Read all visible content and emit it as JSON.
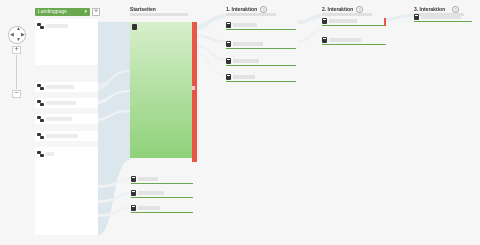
{
  "zoom": {
    "in_label": "+",
    "out_label": "−"
  },
  "dimension_selector": {
    "label": "Landingpage",
    "caret": "▾"
  },
  "add_button": "+",
  "columns": {
    "start": {
      "title": "Startseiten"
    },
    "int1": {
      "title": "1. Interaktion",
      "info": "?"
    },
    "int2": {
      "title": "2. Interaktion",
      "info": "?"
    },
    "int3": {
      "title": "3. Interaktion",
      "info": "?"
    }
  },
  "colors": {
    "accent_green": "#6aa84f",
    "flow": "#dde9ee",
    "dropoff_red": "#e8564a",
    "node_green_top": "#d7efcb",
    "node_green_bottom": "#8fd17a"
  }
}
